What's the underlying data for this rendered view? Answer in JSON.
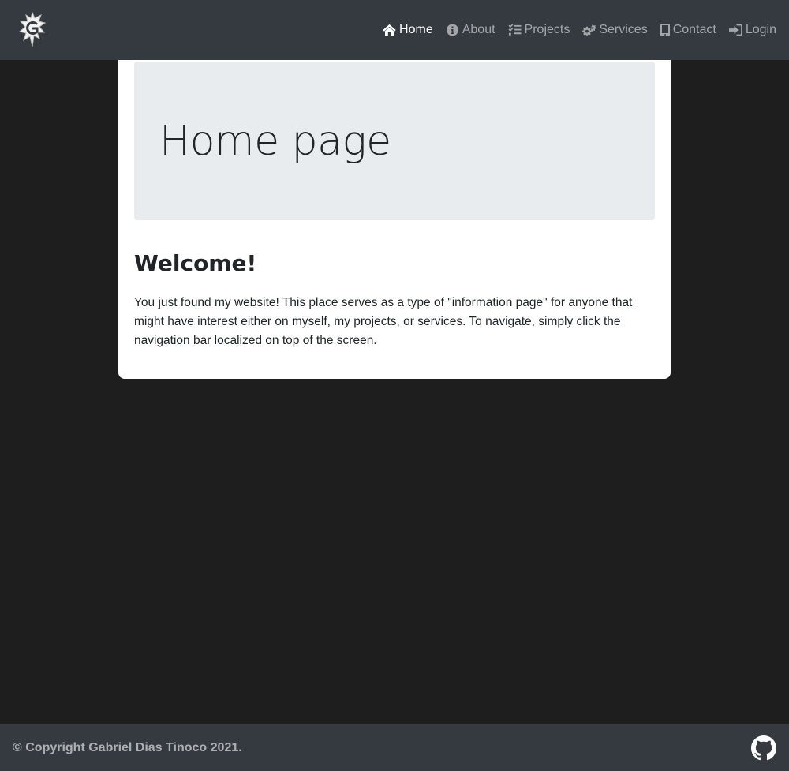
{
  "navbar": {
    "logo_icon": "stylized-g-logo-icon",
    "links": [
      {
        "label": "Home",
        "icon": "home-icon",
        "active": true
      },
      {
        "label": "About",
        "icon": "info-circle-icon",
        "active": false
      },
      {
        "label": "Projects",
        "icon": "tasks-list-icon",
        "active": false
      },
      {
        "label": "Services",
        "icon": "gears-icon",
        "active": false
      },
      {
        "label": "Contact",
        "icon": "mobile-phone-icon",
        "active": false
      },
      {
        "label": "Login",
        "icon": "sign-in-icon",
        "active": false
      }
    ]
  },
  "main": {
    "jumbotron_title": "Home page",
    "welcome_title": "Welcome!",
    "welcome_text": "You just found my website! This place serves as a type of \"information page\" for anyone that might have interest either on myself, my projects, or services. To navigate, simply click the navigation bar localized on top of the screen."
  },
  "footer": {
    "copyright": "© Copyright Gabriel Dias Tinoco 2021.",
    "github_icon": "github-icon"
  },
  "colors": {
    "background": "#1e1e1f",
    "navbar": "#343a40",
    "card": "#ffffff",
    "jumbotron": "#e9ecef",
    "nav_active": "#ffffff",
    "nav_inactive": "rgba(255,255,255,0.55)"
  }
}
